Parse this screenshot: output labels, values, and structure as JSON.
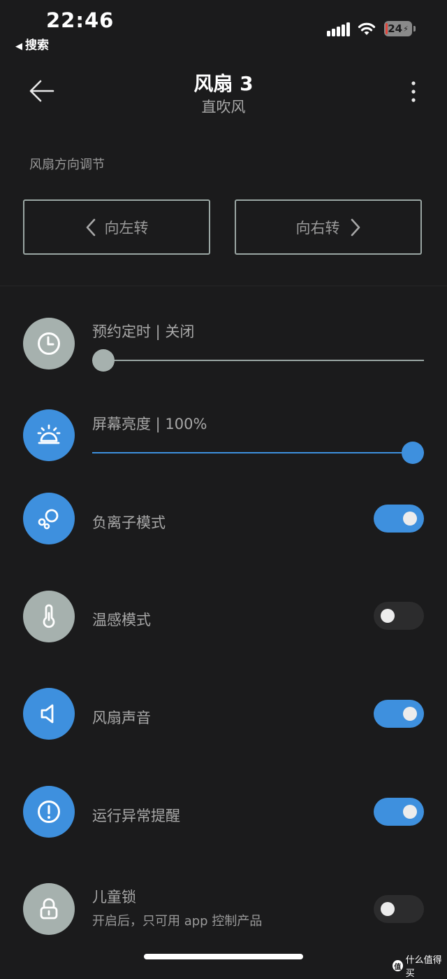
{
  "status_bar": {
    "time": "22:46",
    "back_app": "搜索",
    "battery": "24"
  },
  "header": {
    "title": "风扇 3",
    "subtitle": "直吹风"
  },
  "direction": {
    "section_label": "风扇方向调节",
    "left_label": "向左转",
    "right_label": "向右转"
  },
  "settings": {
    "timer": {
      "label": "预约定时 | 关闭",
      "value_percent": 0,
      "icon": "clock-icon"
    },
    "brightness": {
      "label": "屏幕亮度 | 100%",
      "value_percent": 100,
      "icon": "sunrise-icon"
    },
    "anion": {
      "label": "负离子模式",
      "on": true,
      "icon": "bubbles-icon"
    },
    "temp_sense": {
      "label": "温感模式",
      "on": false,
      "icon": "thermometer-icon"
    },
    "sound": {
      "label": "风扇声音",
      "on": true,
      "icon": "speaker-icon"
    },
    "alert": {
      "label": "运行异常提醒",
      "on": true,
      "icon": "alert-icon"
    },
    "child_lock": {
      "label": "儿童锁",
      "sub": "开启后，只可用 app 控制产品",
      "on": false,
      "icon": "lock-icon"
    }
  },
  "watermark": {
    "text": "什么值得买",
    "badge": "值"
  },
  "colors": {
    "background": "#1b1b1c",
    "accent": "#3e90de",
    "inactive": "#a6b1ae"
  }
}
